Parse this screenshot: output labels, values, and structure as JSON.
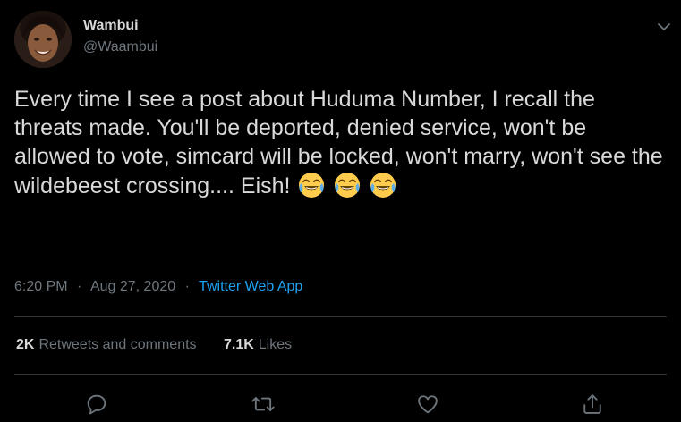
{
  "user": {
    "name": "Wambui",
    "handle": "@Waambui"
  },
  "tweet": {
    "text": "Every time I see a post about Huduma Number, I recall the threats made. You'll be deported, denied service, won't be allowed to vote, simcard will be locked, won't marry, won't see the wildebeest crossing.... Eish!",
    "emojis": [
      "😂",
      "😂",
      "😂"
    ],
    "time": "6:20 PM",
    "separator": "·",
    "date": "Aug 27, 2020",
    "source": "Twitter Web App"
  },
  "stats": {
    "retweets_count": "2K",
    "retweets_label": "Retweets and comments",
    "likes_count": "7.1K",
    "likes_label": "Likes"
  },
  "icons": {
    "menu": "chevron-down-icon",
    "reply": "reply-icon",
    "retweet": "retweet-icon",
    "like": "heart-icon",
    "share": "share-icon"
  },
  "colors": {
    "background": "#000000",
    "text": "#d9d9d9",
    "secondary_text": "#6e767d",
    "link": "#1da1f2",
    "divider": "#2f3336"
  }
}
